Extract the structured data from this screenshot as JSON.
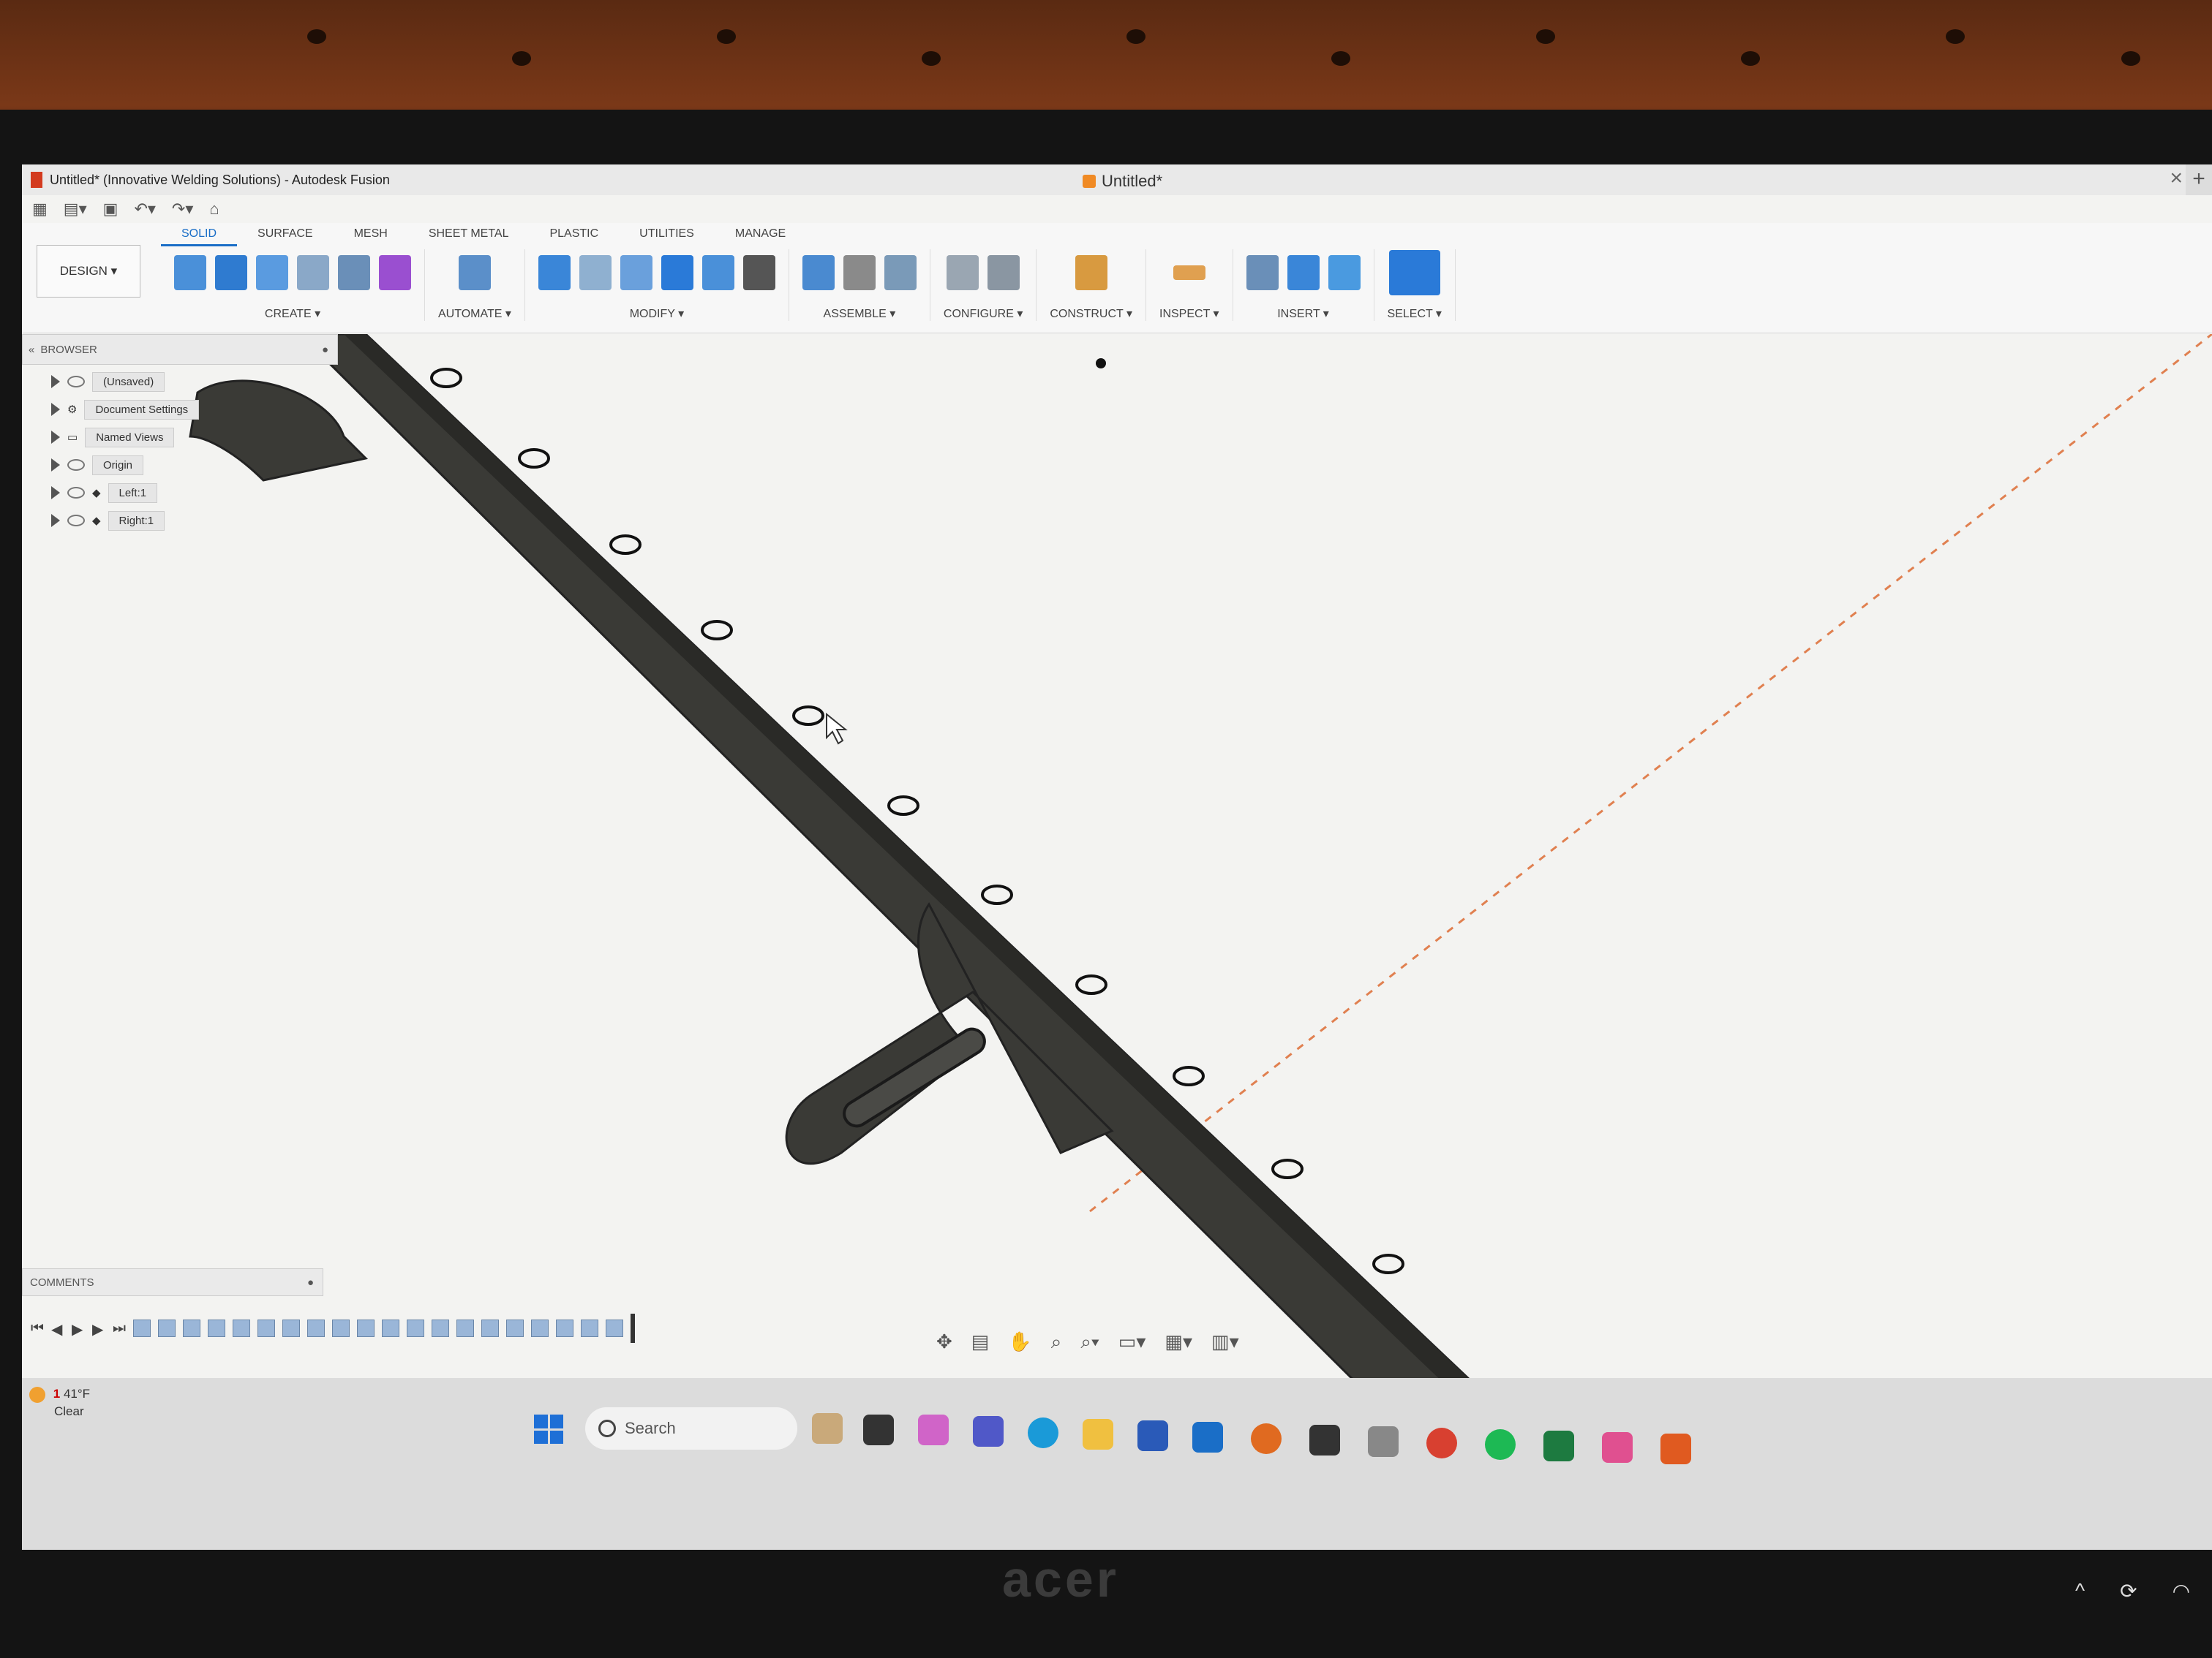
{
  "window": {
    "title": "Untitled* (Innovative Welding Solutions) - Autodesk Fusion",
    "doc_tab": "Untitled*",
    "close": "×",
    "new_tab": "+"
  },
  "ribbon": {
    "workspace": "DESIGN ▾",
    "tabs": [
      "SOLID",
      "SURFACE",
      "MESH",
      "SHEET METAL",
      "PLASTIC",
      "UTILITIES",
      "MANAGE"
    ],
    "groups": {
      "create": "CREATE ▾",
      "automate": "AUTOMATE ▾",
      "modify": "MODIFY ▾",
      "assemble": "ASSEMBLE ▾",
      "configure": "CONFIGURE ▾",
      "construct": "CONSTRUCT ▾",
      "inspect": "INSPECT ▾",
      "insert": "INSERT ▾",
      "select": "SELECT ▾"
    }
  },
  "browser": {
    "title": "BROWSER",
    "root": "(Unsaved)",
    "items": [
      "Document Settings",
      "Named Views",
      "Origin",
      "Left:1",
      "Right:1"
    ]
  },
  "comments": {
    "title": "COMMENTS"
  },
  "weather": {
    "temp": "41°F",
    "cond": "Clear",
    "badge": "1"
  },
  "taskbar": {
    "search": "Search"
  },
  "monitor": {
    "brand": "acer"
  },
  "colors": {
    "accent": "#1a6ec7",
    "part": "#3a3a36",
    "wall": "#7a3818"
  }
}
